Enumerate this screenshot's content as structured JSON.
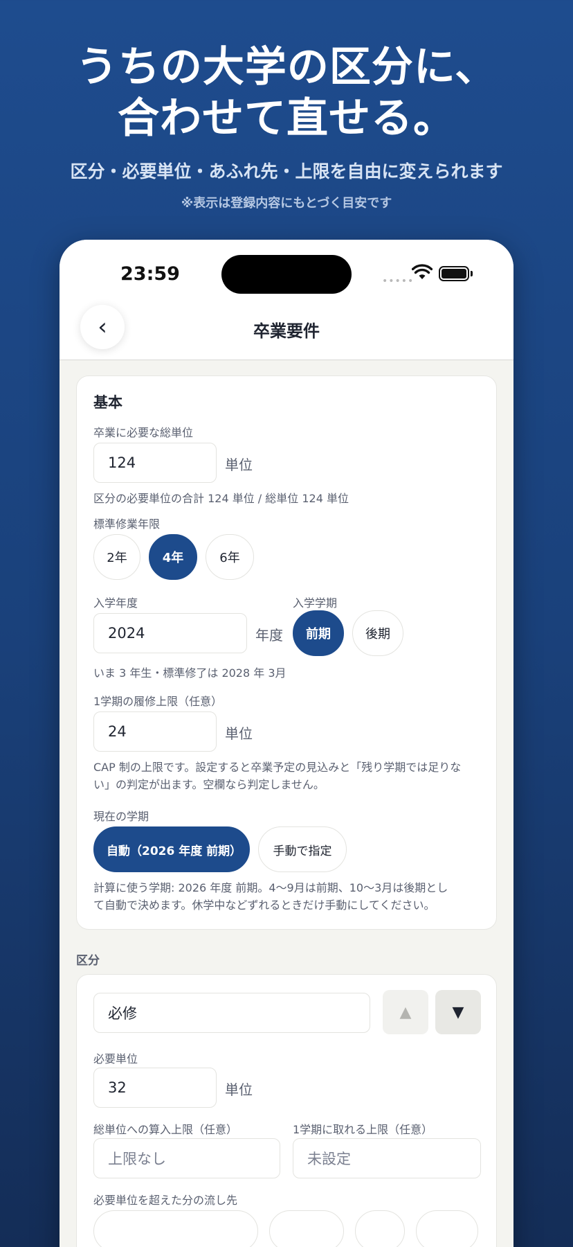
{
  "hero": {
    "title_line1": "うちの大学の区分に、",
    "title_line2": "合わせて直せる。",
    "subtitle": "区分・必要単位・あふれ先・上限を自由に変えられます",
    "note": "※表示は登録内容にもとづく目安です"
  },
  "status_bar": {
    "time": "23:59",
    "signal": "•••••"
  },
  "nav": {
    "back_glyph": "‹",
    "title": "卒業要件"
  },
  "basic": {
    "title": "基本",
    "total_label": "卒業に必要な総単位",
    "total_value": "124",
    "total_unit": "単位",
    "total_help": "区分の必要単位の合計 124 単位 / 総単位 124 単位",
    "years_label": "標準修業年限",
    "years_options": [
      "2年",
      "4年",
      "6年"
    ],
    "years_selected": "4年",
    "entry_year_label": "入学年度",
    "entry_year_value": "2024",
    "entry_year_unit": "年度",
    "entry_term_label": "入学学期",
    "entry_term_options": [
      "前期",
      "後期"
    ],
    "entry_term_selected": "前期",
    "entry_help": "いま 3 年生・標準修了は 2028 年 3月",
    "cap_label": "1学期の履修上限（任意）",
    "cap_value": "24",
    "cap_unit": "単位",
    "cap_help_line1": "CAP 制の上限です。設定すると卒業予定の見込みと「残り学期では足りな",
    "cap_help_line2": "い」の判定が出ます。空欄なら判定しません。",
    "current_term_label": "現在の学期",
    "current_term_auto": "自動（2026 年度 前期）",
    "current_term_manual": "手動で指定",
    "current_term_help_line1": "計算に使う学期: 2026 年度 前期。4〜9月は前期、10〜3月は後期とし",
    "current_term_help_line2": "て自動で決めます。休学中などずれるときだけ手動にしてください。"
  },
  "categories": {
    "section_label": "区分",
    "name_value": "必修",
    "up_glyph": "▲",
    "down_glyph": "▼",
    "required_label": "必要単位",
    "required_value": "32",
    "required_unit": "単位",
    "total_cap_label": "総単位への算入上限（任意）",
    "total_cap_placeholder": "上限なし",
    "term_cap_label": "1学期に取れる上限（任意）",
    "term_cap_placeholder": "未設定",
    "overflow_label": "必要単位を超えた分の流し先"
  },
  "colors": {
    "accent": "#1d4b8c",
    "background_top": "#1e4c8e",
    "background_bottom": "#142d57"
  },
  "icons": {
    "back": "chevron-left-icon",
    "wifi": "wifi-icon",
    "battery": "battery-icon"
  }
}
